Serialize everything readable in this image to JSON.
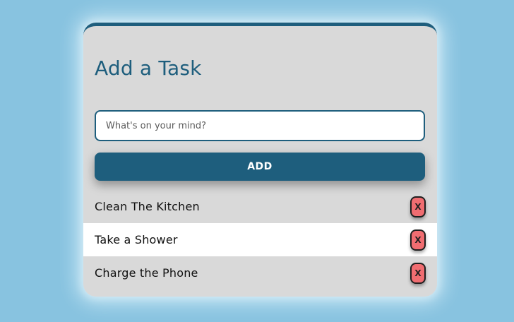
{
  "app": {
    "title": "Add a Task"
  },
  "input": {
    "value": "",
    "placeholder": "What's on your mind?"
  },
  "add_button": {
    "label": "ADD"
  },
  "tasks": [
    {
      "text": "Clean The Kitchen",
      "delete_label": "X"
    },
    {
      "text": "Take a Shower",
      "delete_label": "X"
    },
    {
      "text": "Charge the Phone",
      "delete_label": "X"
    }
  ],
  "colors": {
    "page_background": "#88c3e0",
    "card_background": "#d9d9d9",
    "accent": "#1e5e7d",
    "delete_button": "#f06d71",
    "row_highlight": "#ffffff"
  },
  "icons": {
    "delete": "close-icon"
  }
}
